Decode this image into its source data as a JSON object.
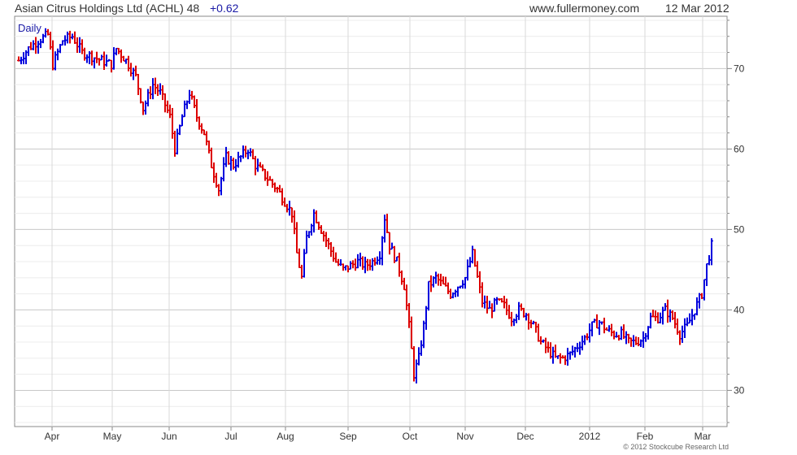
{
  "header": {
    "title": "Asian Citrus Holdings Ltd (ACHL) 48",
    "change": "+0.62",
    "site": "www.fullermoney.com",
    "date": "12 Mar 2012"
  },
  "copyright": "© 2012 Stockcube Research Ltd",
  "chart_data": {
    "type": "ohlc",
    "period_label": "Daily",
    "ylim": [
      25.5,
      76.5
    ],
    "y_ticks": [
      30,
      40,
      50,
      60,
      70
    ],
    "x_ticks": [
      "Apr",
      "May",
      "Jun",
      "Jul",
      "Aug",
      "Sep",
      "Oct",
      "Nov",
      "Dec",
      "2012",
      "Feb",
      "Mar"
    ],
    "grid": true,
    "up_color": "#0000dd",
    "down_color": "#dd0000",
    "price_path": [
      [
        0,
        71
      ],
      [
        4,
        72.5
      ],
      [
        8,
        73.5
      ],
      [
        12,
        74.2
      ],
      [
        14,
        70.5
      ],
      [
        18,
        73.5
      ],
      [
        22,
        74
      ],
      [
        26,
        72
      ],
      [
        30,
        71.5
      ],
      [
        34,
        71
      ],
      [
        38,
        70.5
      ],
      [
        40,
        72.5
      ],
      [
        44,
        71
      ],
      [
        48,
        69
      ],
      [
        51,
        65
      ],
      [
        55,
        68
      ],
      [
        58,
        67
      ],
      [
        62,
        64
      ],
      [
        64,
        60
      ],
      [
        67,
        64
      ],
      [
        70,
        67
      ],
      [
        73,
        64
      ],
      [
        76,
        62
      ],
      [
        79,
        58
      ],
      [
        82,
        55
      ],
      [
        85,
        59
      ],
      [
        88,
        58
      ],
      [
        91,
        59
      ],
      [
        94,
        60
      ],
      [
        97,
        58
      ],
      [
        100,
        57
      ],
      [
        103,
        56
      ],
      [
        106,
        55
      ],
      [
        109,
        53.5
      ],
      [
        112,
        52
      ],
      [
        114,
        47
      ],
      [
        116,
        44
      ],
      [
        118,
        49
      ],
      [
        121,
        52
      ],
      [
        124,
        50
      ],
      [
        127,
        48
      ],
      [
        130,
        46
      ],
      [
        133,
        45
      ],
      [
        136,
        45.5
      ],
      [
        139,
        46
      ],
      [
        142,
        45.5
      ],
      [
        145,
        46
      ],
      [
        148,
        47
      ],
      [
        150,
        51.5
      ],
      [
        152,
        48
      ],
      [
        155,
        46
      ],
      [
        158,
        43
      ],
      [
        160,
        38
      ],
      [
        162,
        32
      ],
      [
        164,
        34
      ],
      [
        166,
        38
      ],
      [
        168,
        43
      ],
      [
        171,
        44
      ],
      [
        174,
        43
      ],
      [
        177,
        42
      ],
      [
        180,
        43
      ],
      [
        183,
        44
      ],
      [
        186,
        47
      ],
      [
        188,
        44
      ],
      [
        190,
        41
      ],
      [
        193,
        40
      ],
      [
        196,
        41
      ],
      [
        199,
        40.5
      ],
      [
        202,
        39
      ],
      [
        205,
        40
      ],
      [
        208,
        39.5
      ],
      [
        211,
        38
      ],
      [
        214,
        36
      ],
      [
        217,
        35
      ],
      [
        220,
        34
      ],
      [
        223,
        34
      ],
      [
        226,
        34.5
      ],
      [
        229,
        35.5
      ],
      [
        232,
        36.5
      ],
      [
        235,
        38
      ],
      [
        238,
        38.5
      ],
      [
        241,
        37.5
      ],
      [
        244,
        37
      ],
      [
        247,
        37
      ],
      [
        250,
        36
      ],
      [
        253,
        36
      ],
      [
        256,
        36.5
      ],
      [
        259,
        39
      ],
      [
        262,
        39
      ],
      [
        265,
        40
      ],
      [
        268,
        39
      ],
      [
        271,
        37
      ],
      [
        274,
        38
      ],
      [
        277,
        40
      ],
      [
        280,
        42
      ],
      [
        282,
        45.5
      ],
      [
        284,
        48
      ]
    ]
  }
}
